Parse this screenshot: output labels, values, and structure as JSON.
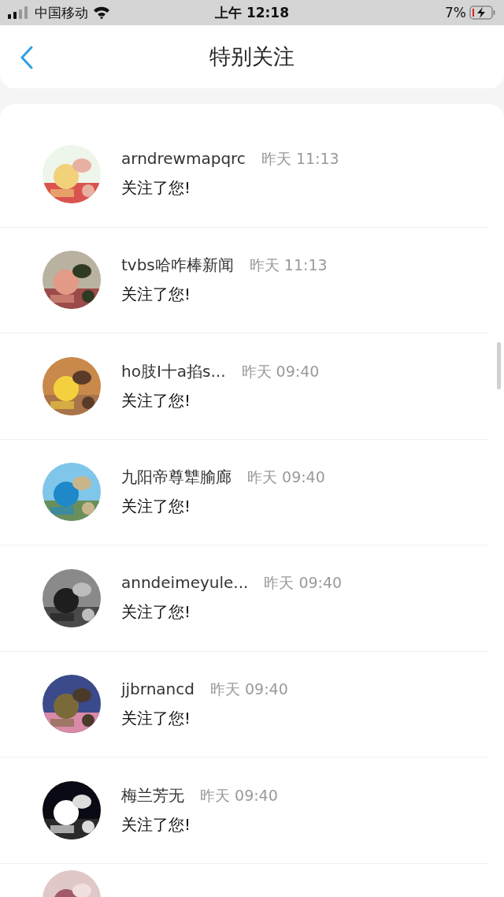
{
  "status_bar": {
    "carrier": "中国移动",
    "time": "上午 12:18",
    "battery": "7%"
  },
  "header": {
    "title": "特别关注"
  },
  "items": [
    {
      "name": "arndrewmapqrc",
      "time": "昨天 11:13",
      "message": "关注了您!"
    },
    {
      "name": "tvbs哈咋棒新闻",
      "time": "昨天 11:13",
      "message": "关注了您!"
    },
    {
      "name": "ho肢I十a掐s...",
      "time": "昨天 09:40",
      "message": "关注了您!"
    },
    {
      "name": "九阳帝尊犨腧廊",
      "time": "昨天 09:40",
      "message": "关注了您!"
    },
    {
      "name": "anndeimeyule...",
      "time": "昨天 09:40",
      "message": "关注了您!"
    },
    {
      "name": "jjbrnancd",
      "time": "昨天 09:40",
      "message": "关注了您!"
    },
    {
      "name": "梅兰芳无",
      "time": "昨天 09:40",
      "message": "关注了您!"
    }
  ]
}
